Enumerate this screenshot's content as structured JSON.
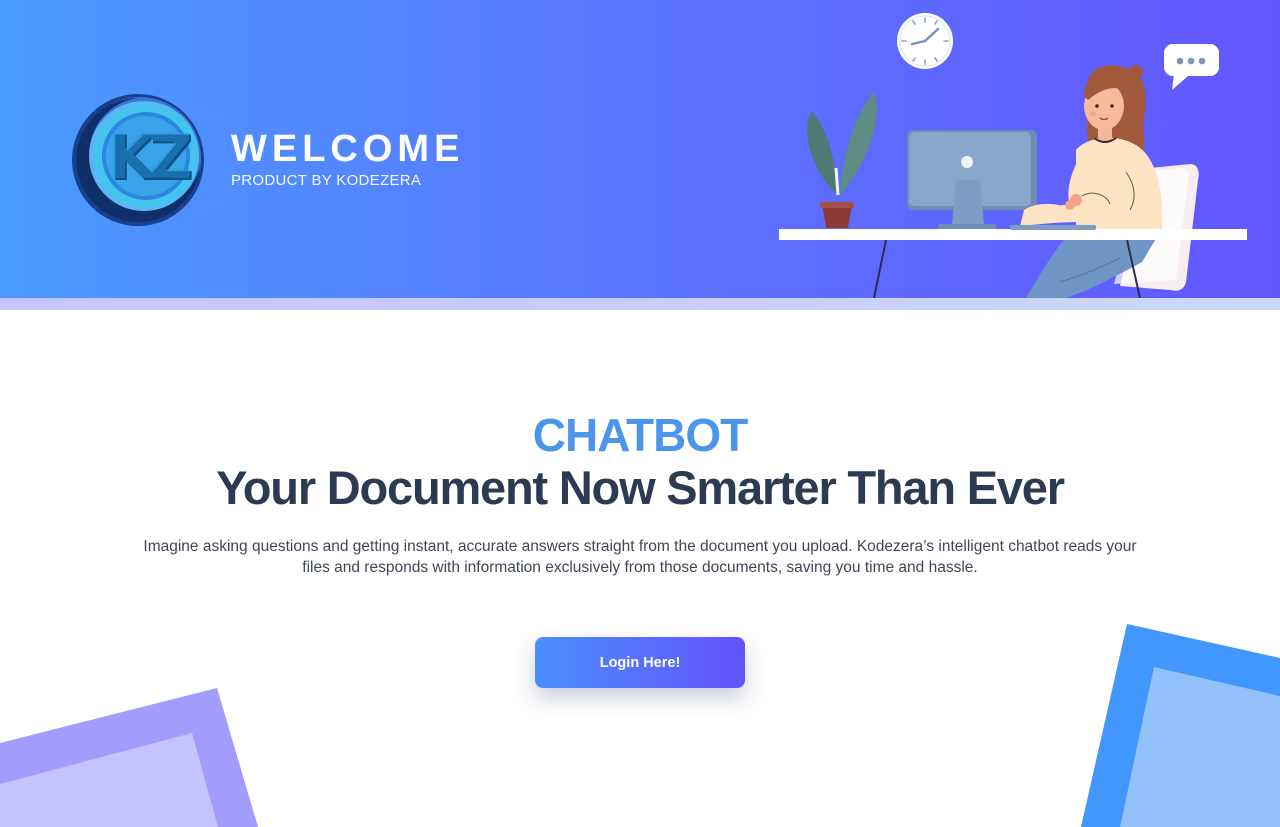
{
  "header": {
    "title": "WELCOME",
    "subtitle": "PRODUCT BY KODEZERA",
    "logo_icon": "kz-logo-icon",
    "illustration_icon": "person-at-desk-illustration",
    "colors": {
      "gradient_start": "#4a9bff",
      "gradient_end": "#6257ff"
    }
  },
  "hero": {
    "kicker": "CHATBOT",
    "title": "Your Document Now Smarter Than Ever",
    "description": "Imagine asking questions and getting instant, accurate answers straight from the document you upload. Kodezera’s intelligent chatbot reads your files and responds with information exclusively from those documents, saving you time and hassle.",
    "login_label": "Login Here!",
    "colors": {
      "kicker": "#4b96ea",
      "title": "#2d3b52",
      "button_start": "#4b8ffd",
      "button_end": "#6352fb"
    }
  }
}
